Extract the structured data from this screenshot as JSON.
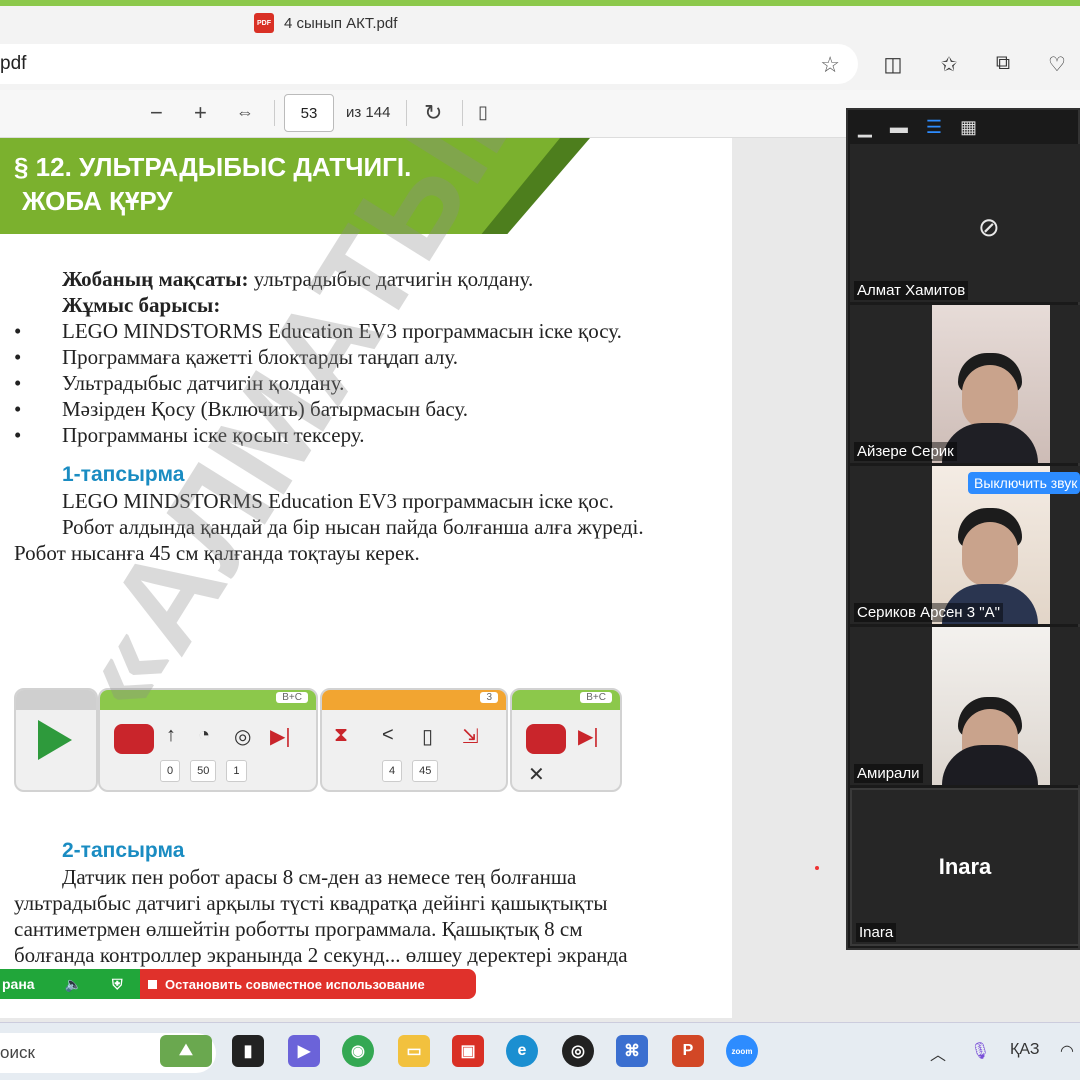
{
  "browser": {
    "tab_title": "4 сынып АКТ.pdf",
    "pdf_badge": "PDF",
    "address": "pdf"
  },
  "pdf_toolbar": {
    "current_page": "53",
    "page_count": "из 144"
  },
  "page": {
    "banner_line1": "§ 12. УЛЬТРАДЫБЫС ДАТЧИГІ.",
    "banner_line2": "ЖОБА ҚҰРУ",
    "goal_label": "Жобаның мақсаты:",
    "goal_text": " ультрадыбыс датчигін қолдану.",
    "work_label": "Жұмыс барысы:",
    "bullets": [
      "LEGO MINDSTORMS Education EV3 программасын іске қосу.",
      "Программаға қажетті блоктарды таңдап алу.",
      "Ультрадыбыс датчигін қолдану.",
      "Мәзірден Қосу (Включить) батырмасын басу.",
      "Программаны іске қосып тексеру."
    ],
    "task1_title": "1-тапсырма",
    "task1_line1": "LEGO MINDSTORMS Education EV3 программасын іске қос.",
    "task1_line2": "Робот алдында қандай да бір нысан пайда болғанша алға жүреді. Робот нысанға 45 см қалғанда тоқтауы керек.",
    "task2_title": "2-тапсырма",
    "task2_text": "Датчик пен робот арасы 8 см-ден аз немесе тең болғанша ультрадыбыс датчигі арқылы түсті квадратқа дейінгі қашықтықты сантиметрмен өлшейтін роботты программала. Қашықтық 8 см болғанда контроллер экранында 2 секунд... өлшеу деректері экранда көрінуі керек.",
    "watermark": "«АЛМАТЫКІТАП баспасы»",
    "blocks": {
      "tag1": "B+C",
      "vals1": [
        "0",
        "50",
        "1"
      ],
      "tag2": "3",
      "vals2": [
        "4",
        "45"
      ],
      "tag3": "B+C"
    }
  },
  "zoom": {
    "share_status": "рана",
    "stop_share": "Остановить совместное использование",
    "participants": [
      {
        "name": "Алмат Хамитов",
        "video": false
      },
      {
        "name": "Айзере Серик",
        "video": true
      },
      {
        "name": "Сериков Арсен 3 \"А\"",
        "video": true
      },
      {
        "name": "Амирали",
        "video": true
      },
      {
        "name": "Inara",
        "video": false,
        "display": "Inara"
      }
    ],
    "tooltip": "Выключить звук"
  },
  "taskbar": {
    "search": "оиск",
    "lang": "ҚАЗ",
    "zoom_label": "zoom"
  },
  "colors": {
    "banner": "#7bb12e",
    "task_heading": "#1a8cc2",
    "share_green": "#21a63a",
    "share_red": "#e0312b",
    "zoom_blue": "#2d8cff"
  }
}
